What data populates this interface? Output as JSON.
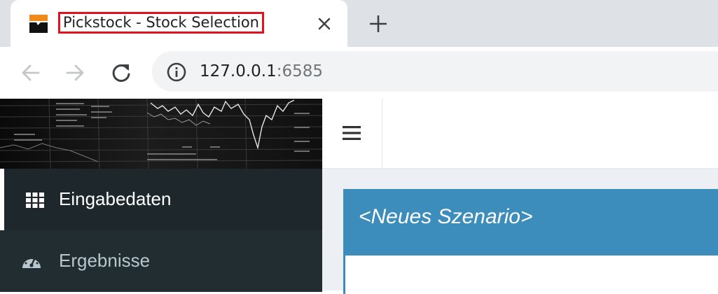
{
  "browser": {
    "tab": {
      "title": "Pickstock - Stock Selection",
      "favicon": "pickstock-logo-icon",
      "close_icon": "close-icon"
    },
    "new_tab_icon": "plus-icon",
    "nav": {
      "back_icon": "arrow-left-icon",
      "forward_icon": "arrow-right-icon",
      "reload_icon": "reload-icon"
    },
    "address": {
      "security_icon": "info-icon",
      "host": "127.0.0.1",
      "port": ":6585"
    }
  },
  "app": {
    "header": {
      "menu_toggle_icon": "hamburger-icon"
    },
    "banner": {
      "image": "stock-chart-banner"
    },
    "sidebar": {
      "items": [
        {
          "label": "Eingabedaten",
          "icon": "grid-icon",
          "active": true
        },
        {
          "label": "Ergebnisse",
          "icon": "dashboard-gauge-icon",
          "active": false
        }
      ]
    },
    "main": {
      "box_title": "<Neues Szenario>"
    },
    "colors": {
      "sidebar_bg": "#222d32",
      "sidebar_active_bg": "#1e282c",
      "primary": "#3c8dbc",
      "content_bg": "#ecf0f5",
      "tab_highlight": "#e0141e"
    }
  }
}
